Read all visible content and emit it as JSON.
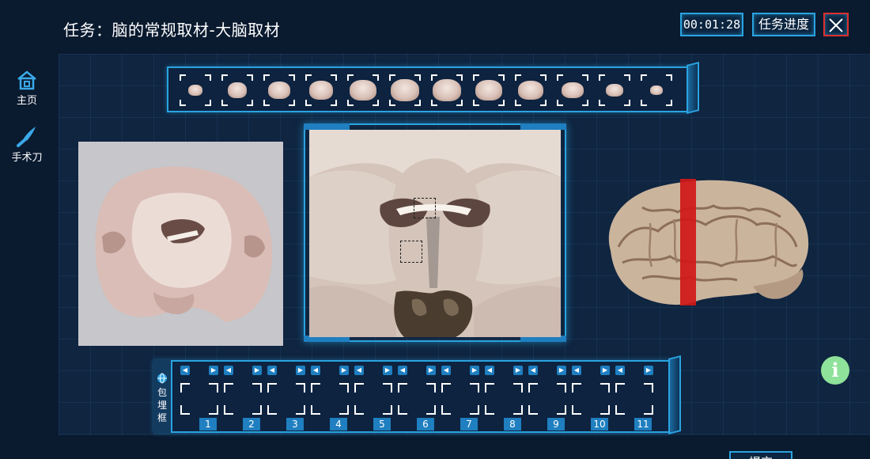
{
  "header": {
    "title": "任务：脑的常规取材-大脑取材",
    "timer": "00:01:28",
    "progress_label": "任务进度",
    "close_icon": "close-icon"
  },
  "sidebar": {
    "items": [
      {
        "label": "主页",
        "icon": "home-icon"
      },
      {
        "label": "手术刀",
        "icon": "scalpel-icon"
      }
    ]
  },
  "slice_strip": {
    "count": 12
  },
  "embedding_panel": {
    "label": "包埋框",
    "icon": "globe-icon",
    "cassettes": [
      "1",
      "2",
      "3",
      "4",
      "5",
      "6",
      "7",
      "8",
      "9",
      "10",
      "11"
    ]
  },
  "info_icon": "info-icon",
  "submit_label": "提交",
  "colors": {
    "background": "#0a1a2f",
    "accent": "#2aa3e0",
    "close_border": "#e0302f",
    "info_green": "#8fe29a",
    "cut_marker": "#d01818"
  }
}
